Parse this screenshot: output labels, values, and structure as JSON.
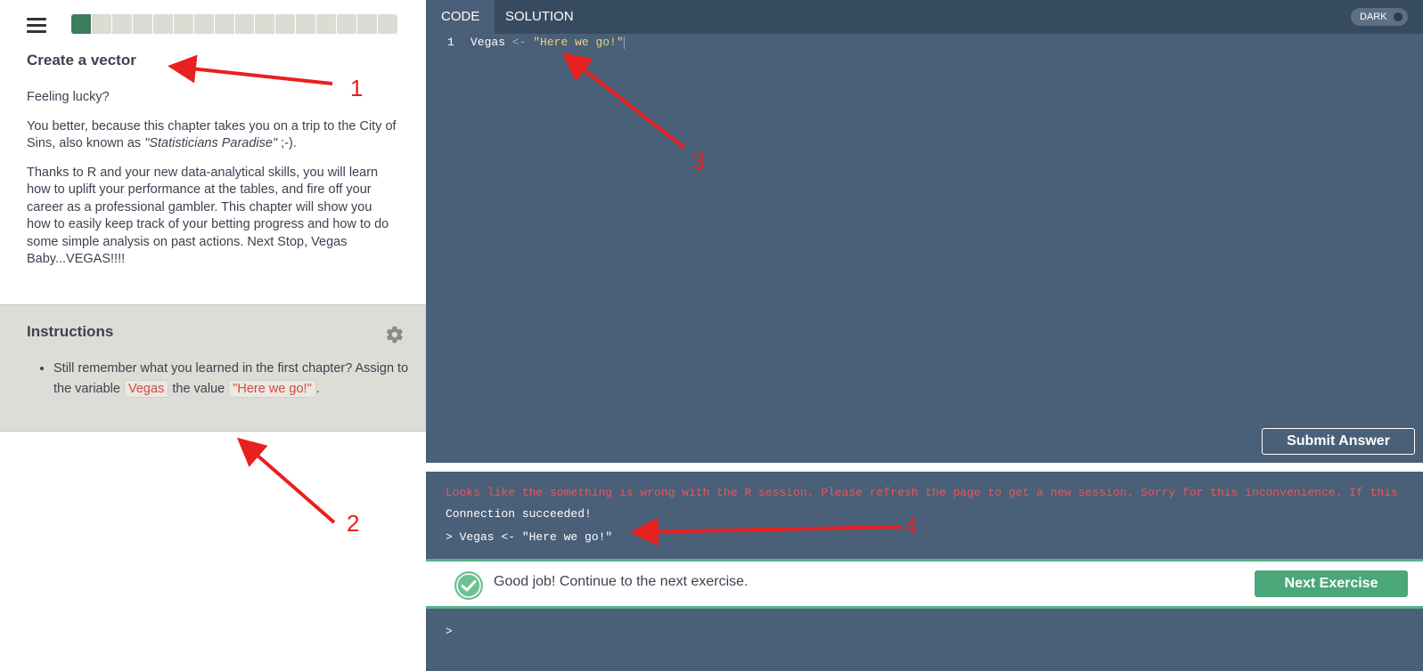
{
  "lesson": {
    "progress": {
      "total_segments": 16,
      "completed_segments": 1
    },
    "title": "Create a vector",
    "body": {
      "p1": "Feeling lucky?",
      "p2_pre": "You better, because this chapter takes you on a trip to the City of Sins, also known as ",
      "p2_em": "\"Statisticians Paradise\"",
      "p2_post": " ;-).",
      "p3": "Thanks to R and your new data-analytical skills, you will learn how to uplift your performance at the tables, and fire off your career as a professional gambler. This chapter will show you how to easily keep track of your betting progress and how to do some simple analysis on past actions. Next Stop, Vegas Baby...VEGAS!!!!"
    }
  },
  "instructions": {
    "title": "Instructions",
    "item_pre": "Still remember what you learned in the first chapter? Assign to the variable ",
    "item_var": "Vegas",
    "item_mid": " the value ",
    "item_val": "\"Here we go!\"",
    "item_post": "."
  },
  "editor": {
    "tabs": {
      "code": "CODE",
      "solution": "SOLUTION"
    },
    "dark_toggle": "DARK",
    "line_number": "1",
    "code": {
      "ident": "Vegas",
      "op": " <- ",
      "str": "\"Here we go!\""
    },
    "submit_label": "Submit Answer"
  },
  "console": {
    "error": "Looks like the something is wrong with the R session. Please refresh the page to get a new session. Sorry for this inconvenience. If this",
    "status": "Connection succeeded!",
    "command": "> Vegas <- \"Here we go!\"",
    "prompt": ">"
  },
  "feedback": {
    "message": "Good job! Continue to the next exercise.",
    "next_label": "Next Exercise"
  },
  "annotations": {
    "n1": "1",
    "n2": "2",
    "n3": "3",
    "n4": "4"
  },
  "colors": {
    "accent_green": "#4aa77a",
    "editor_bg": "#4a5f78",
    "annotation_red": "#e8201f"
  }
}
